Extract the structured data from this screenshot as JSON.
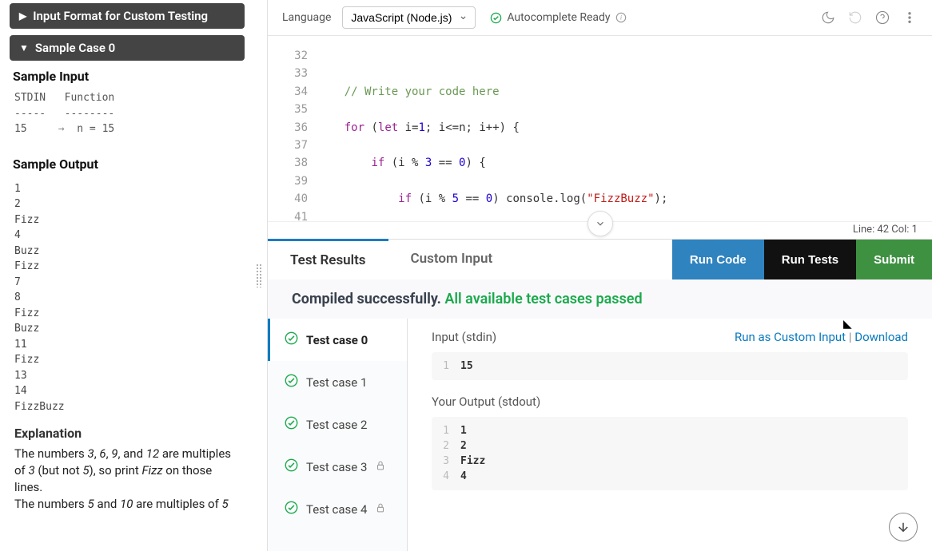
{
  "sidebar": {
    "header_input_format": "Input Format for Custom Testing",
    "header_sample_case": "Sample Case 0",
    "sample_input_label": "Sample Input",
    "stdin_header": "STDIN",
    "func_header": "Function",
    "stdin_underline": "-----",
    "func_underline": "--------",
    "stdin_value": "15",
    "arrow": "→",
    "func_value": "n = 15",
    "sample_output_label": "Sample Output",
    "sample_output_lines": [
      "1",
      "2",
      "Fizz",
      "4",
      "Buzz",
      "Fizz",
      "7",
      "8",
      "Fizz",
      "Buzz",
      "11",
      "Fizz",
      "13",
      "14",
      "FizzBuzz"
    ],
    "explanation_label": "Explanation",
    "explanation_html": "The numbers <i>3</i>, <i>6</i>, <i>9</i>, and <i>12</i> are multiples of <i>3</i> (but not <i>5</i>), so print <i>Fizz</i> on those lines.<br>The numbers <i>5</i> and <i>10</i> are multiples of <i>5</i>"
  },
  "toolbar": {
    "language_label": "Language",
    "language_value": "JavaScript (Node.js)",
    "autocomplete_label": "Autocomplete Ready"
  },
  "editor": {
    "line_numbers": [
      "32",
      "33",
      "34",
      "35",
      "36",
      "37",
      "38",
      "39",
      "40",
      "41"
    ],
    "status_line": "Line: 42 Col: 1"
  },
  "tabs": {
    "results": "Test Results",
    "custom_input": "Custom Input",
    "run_code": "Run Code",
    "run_tests": "Run Tests",
    "submit": "Submit"
  },
  "compile": {
    "prefix": "Compiled successfully.",
    "suffix": "All available test cases passed"
  },
  "testcases": [
    {
      "label": "Test case 0",
      "selected": true,
      "locked": false
    },
    {
      "label": "Test case 1",
      "selected": false,
      "locked": false
    },
    {
      "label": "Test case 2",
      "selected": false,
      "locked": false
    },
    {
      "label": "Test case 3",
      "selected": false,
      "locked": true
    },
    {
      "label": "Test case 4",
      "selected": false,
      "locked": true
    }
  ],
  "detail": {
    "input_label": "Input (stdin)",
    "run_as_custom": "Run as Custom Input",
    "download": "Download",
    "separator": "|",
    "input_rows": [
      {
        "n": "1",
        "v": "15"
      }
    ],
    "output_label": "Your Output (stdout)",
    "output_rows": [
      {
        "n": "1",
        "v": "1"
      },
      {
        "n": "2",
        "v": "2"
      },
      {
        "n": "3",
        "v": "Fizz"
      },
      {
        "n": "4",
        "v": "4"
      }
    ]
  }
}
